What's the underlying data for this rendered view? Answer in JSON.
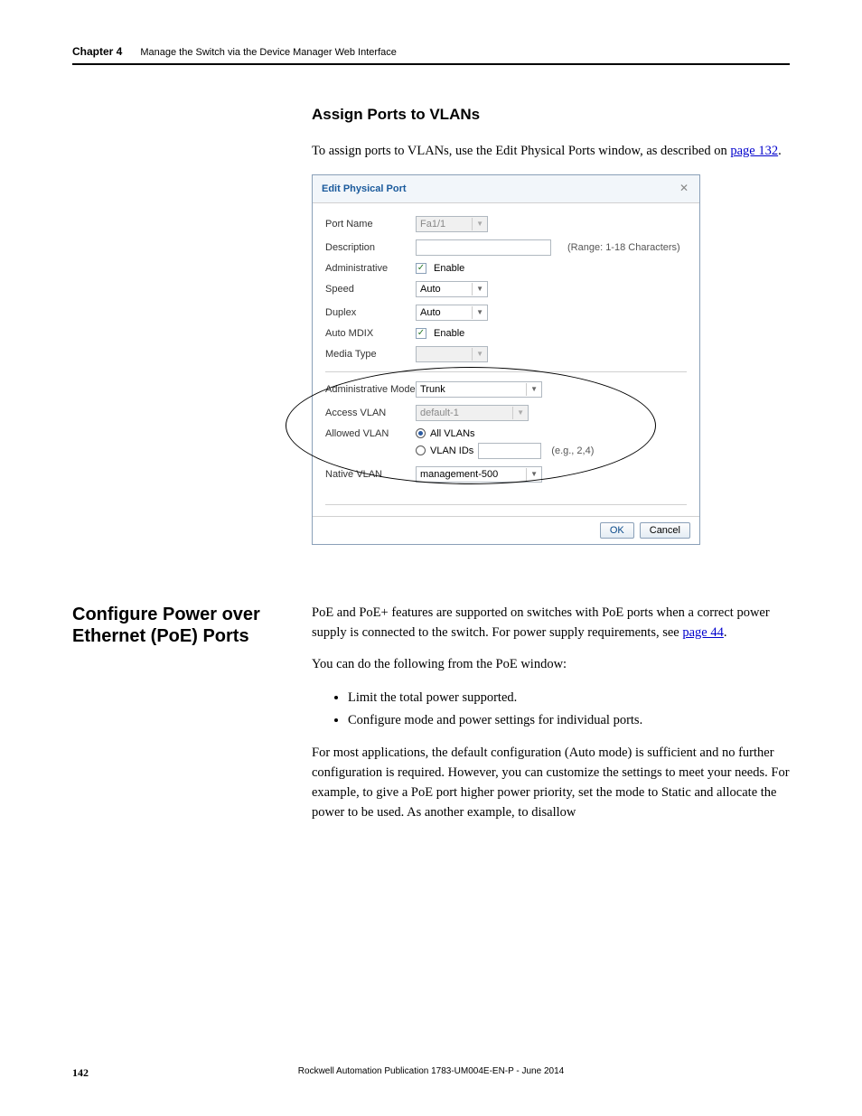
{
  "header": {
    "chapter_label": "Chapter 4",
    "chapter_title": "Manage the Switch via the Device Manager Web Interface"
  },
  "section1": {
    "heading": "Assign Ports to VLANs",
    "body_before_link": "To assign ports to VLANs, use the Edit Physical Ports window, as described on ",
    "link_text": "page 132",
    "body_after_link": "."
  },
  "dialog": {
    "title": "Edit Physical Port",
    "close_glyph": "✕",
    "rows": {
      "port_name": {
        "label": "Port Name",
        "value": "Fa1/1"
      },
      "description": {
        "label": "Description",
        "value": "",
        "hint": "(Range: 1-18 Characters)"
      },
      "administrative": {
        "label": "Administrative",
        "checkbox_label": "Enable",
        "checked": true
      },
      "speed": {
        "label": "Speed",
        "value": "Auto"
      },
      "duplex": {
        "label": "Duplex",
        "value": "Auto"
      },
      "auto_mdix": {
        "label": "Auto MDIX",
        "checkbox_label": "Enable",
        "checked": true
      },
      "media_type": {
        "label": "Media Type",
        "value": ""
      },
      "admin_mode": {
        "label": "Administrative Mode",
        "value": "Trunk"
      },
      "access_vlan": {
        "label": "Access VLAN",
        "value": "default-1"
      },
      "allowed_vlan": {
        "label": "Allowed VLAN",
        "opt_all": "All VLANs",
        "opt_ids": "VLAN IDs",
        "ids_value": "",
        "eg_hint": "(e.g., 2,4)"
      },
      "native_vlan": {
        "label": "Native VLAN",
        "value": "management-500"
      }
    },
    "buttons": {
      "ok": "OK",
      "cancel": "Cancel"
    }
  },
  "section2": {
    "heading": "Configure Power over Ethernet (PoE) Ports",
    "para1_before": "PoE and PoE+ features are supported on switches with PoE ports when a correct power supply is connected to the switch. For power supply requirements, see ",
    "para1_link": "page 44",
    "para1_after": ".",
    "para2": "You can do the following from the PoE window:",
    "bullets": [
      "Limit the total power supported.",
      "Configure mode and power settings for individual ports."
    ],
    "para3": "For most applications, the default configuration (Auto mode) is sufficient and no further configuration is required. However, you can customize the settings to meet your needs. For example, to give a PoE port higher power priority, set the mode to Static and allocate the power to be used. As another example, to disallow"
  },
  "footer": {
    "page_number": "142",
    "publication": "Rockwell Automation Publication 1783-UM004E-EN-P - June 2014"
  }
}
